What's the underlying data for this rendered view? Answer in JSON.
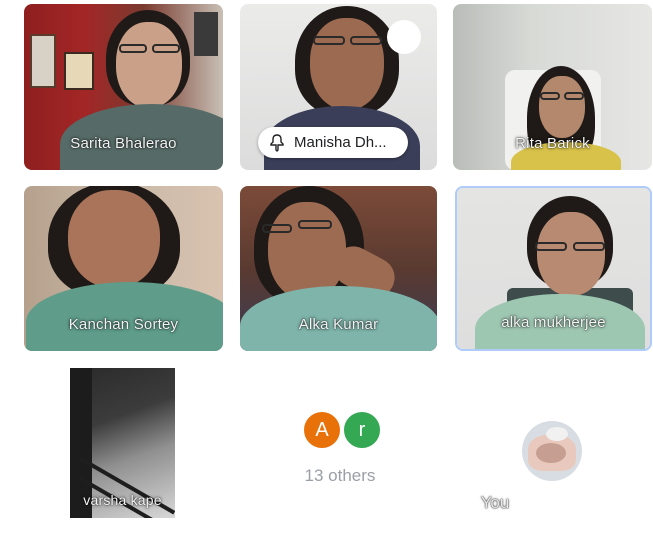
{
  "participants": [
    {
      "name": "Sarita Bhalerao"
    },
    {
      "name": "Manisha Dh..."
    },
    {
      "name": "Rita Barick"
    },
    {
      "name": "Kanchan Sortey"
    },
    {
      "name": "Alka Kumar"
    },
    {
      "name": "alka mukherjee"
    },
    {
      "name": "varsha kape"
    }
  ],
  "others": {
    "avatars": [
      {
        "initial": "A",
        "color": "#e8710a"
      },
      {
        "initial": "r",
        "color": "#34a853"
      }
    ],
    "label": "13 others"
  },
  "self": {
    "label": "You"
  },
  "colors": {
    "active_speaker_border": "#aecbfa",
    "others_text": "#9aa0a6"
  }
}
